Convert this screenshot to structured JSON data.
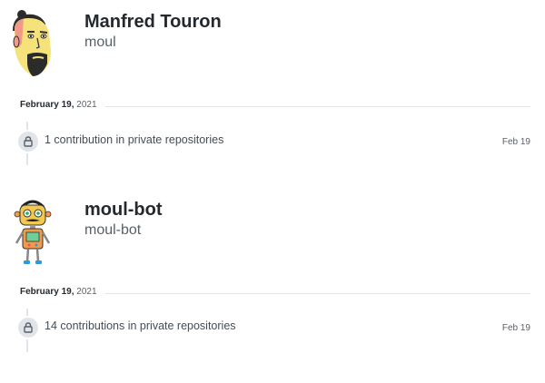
{
  "profiles": [
    {
      "name": "Manfred Touron",
      "login": "moul",
      "date_month_day": "February 19,",
      "date_year": "2021",
      "contribution_text": "1 contribution in private repositories",
      "contribution_date": "Feb 19",
      "avatar_icon": "bearded-man-avatar"
    },
    {
      "name": "moul-bot",
      "login": "moul-bot",
      "date_month_day": "February 19,",
      "date_year": "2021",
      "contribution_text": "14 contributions in private repositories",
      "contribution_date": "Feb 19",
      "avatar_icon": "robot-avatar"
    }
  ],
  "colors": {
    "text": "#24292e",
    "muted": "#586069",
    "rule": "#e1e4e8",
    "badge": "#e1e4e8"
  }
}
